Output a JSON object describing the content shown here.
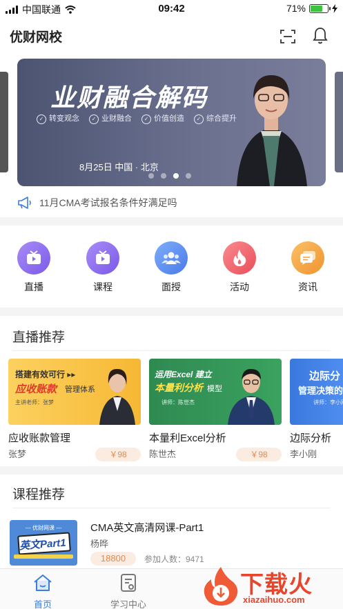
{
  "status_bar": {
    "carrier": "中国联通",
    "time": "09:42",
    "battery": "71%",
    "battery_level": 0.71
  },
  "header": {
    "title": "优财网校"
  },
  "banner": {
    "headline": "业财融合解码",
    "tags": [
      "转变观念",
      "业财融合",
      "价值创造",
      "综合提升"
    ],
    "event": "8月25日  中国 · 北京",
    "page_count": 4,
    "active_page": 3
  },
  "notice": {
    "text": "11月CMA考试报名条件好满足吗"
  },
  "quick_nav": [
    {
      "label": "直播",
      "icon": "tv-icon",
      "color": "#8c6df0"
    },
    {
      "label": "课程",
      "icon": "tv-icon",
      "color": "#8c6df0"
    },
    {
      "label": "面授",
      "icon": "people-icon",
      "color": "#5a8df0"
    },
    {
      "label": "活动",
      "icon": "flame-icon",
      "color": "#f06a70"
    },
    {
      "label": "资讯",
      "icon": "chat-icon",
      "color": "#f5a33f"
    }
  ],
  "live_section": {
    "title": "直播推荐",
    "cards": [
      {
        "name": "应收账款管理",
        "teacher": "张梦",
        "price": "￥98",
        "thumb_line1": "搭建有效可行 ▸▸",
        "thumb_line2": "应收账款",
        "thumb_line3": "管理体系",
        "thumb_caption": "主讲老师：张梦"
      },
      {
        "name": "本量利Excel分析",
        "teacher": "陈世杰",
        "price": "￥98",
        "thumb_line1": "运用Excel 建立",
        "thumb_line2": "本量利分析",
        "thumb_line3": "模型",
        "thumb_caption": "讲师：陈世杰"
      },
      {
        "name": "边际分析",
        "teacher": "李小刚",
        "price": "",
        "thumb_line1": "边际分",
        "thumb_line2": "管理决策的",
        "thumb_line3": "",
        "thumb_caption": "讲师：李小刚"
      }
    ]
  },
  "course_section": {
    "title": "课程推荐",
    "course": {
      "name": "CMA英文高清网课-Part1",
      "teacher": "杨晔",
      "price": "18800",
      "enrolled": "参加人数：9471",
      "thumb_text": "英文Part1",
      "thumb_top": "— 优财网课 —"
    }
  },
  "tabbar": [
    {
      "label": "首页",
      "active": true
    },
    {
      "label": "学习中心",
      "active": false
    }
  ],
  "watermark": {
    "text": "下载火",
    "url": "xiazaihuo.com"
  },
  "colors": {
    "accent": "#3b7ddd",
    "price_bg": "#fbece2",
    "price_text": "#e48a4f"
  }
}
